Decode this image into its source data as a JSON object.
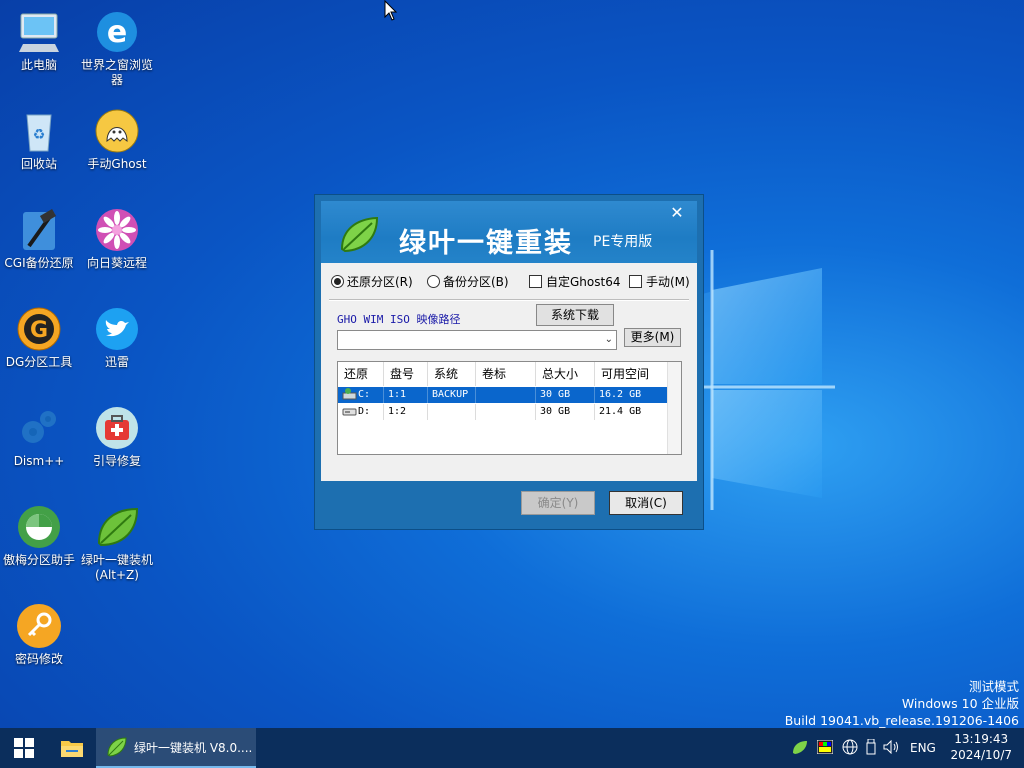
{
  "desktop": {
    "icons": [
      {
        "label": "此电脑"
      },
      {
        "label": "世界之窗浏览器"
      },
      {
        "label": "回收站"
      },
      {
        "label": "手动Ghost"
      },
      {
        "label": "CGI备份还原"
      },
      {
        "label": "向日葵远程"
      },
      {
        "label": "DG分区工具"
      },
      {
        "label": "迅雷"
      },
      {
        "label": "Dism++"
      },
      {
        "label": "引导修复"
      },
      {
        "label": "傲梅分区助手"
      },
      {
        "label": "绿叶一键装机\n(Alt+Z)"
      },
      {
        "label": "密码修改"
      }
    ],
    "watermark": {
      "line1": "测试模式",
      "line2": "Windows 10 企业版",
      "line3": "Build 19041.vb_release.191206-1406"
    }
  },
  "dialog": {
    "title": "绿叶一键重装",
    "subtitle": "PE专用版",
    "close": "✕",
    "options": {
      "restore": "还原分区(R)",
      "backup": "备份分区(B)",
      "custom_ghost": "自定Ghost64",
      "manual": "手动(M)",
      "selected": "restore"
    },
    "path_label": "GHO WIM ISO 映像路径",
    "download_button": "系统下载",
    "path_value": "",
    "more_button": "更多(M)",
    "table": {
      "headers": [
        "还原",
        "盘号",
        "系统",
        "卷标",
        "总大小",
        "可用空间"
      ],
      "rows": [
        {
          "drive": "C:",
          "disk": "1:1",
          "system": "BACKUP",
          "label": "",
          "total": "30 GB",
          "free": "16.2 GB",
          "selected": true
        },
        {
          "drive": "D:",
          "disk": "1:2",
          "system": "",
          "label": "",
          "total": "30 GB",
          "free": "21.4 GB",
          "selected": false
        }
      ]
    },
    "ok_button": "确定(Y)",
    "cancel_button": "取消(C)"
  },
  "taskbar": {
    "app_label": "绿叶一键装机 V8.0....",
    "lang": "ENG",
    "time": "13:19:43",
    "date": "2024/10/7"
  },
  "colors": {
    "accent": "#0a66cc",
    "dialog_frame": "#1d6fb0",
    "taskbar": "#0b2e5c"
  }
}
